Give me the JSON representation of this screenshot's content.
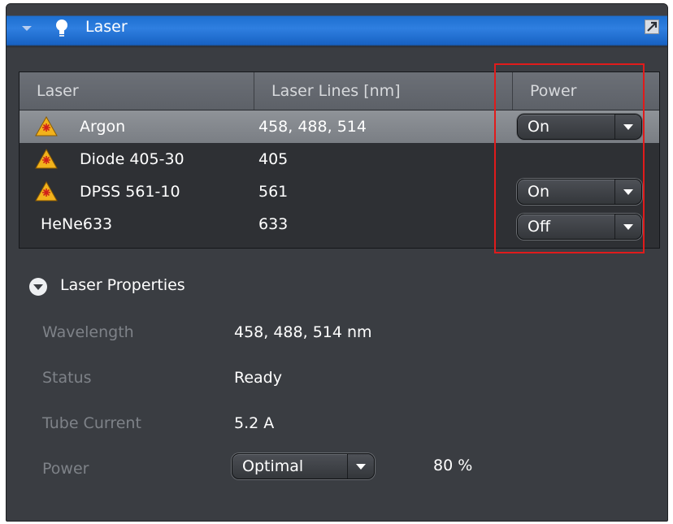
{
  "panel": {
    "title": "Laser"
  },
  "table": {
    "headers": [
      "Laser",
      "Laser Lines [nm]",
      "Power"
    ],
    "rows": [
      {
        "name": "Argon",
        "lines": "458, 488, 514",
        "power": "On",
        "selected": true,
        "warning_icon": true
      },
      {
        "name": "Diode 405-30",
        "lines": "405",
        "power": "",
        "selected": false,
        "warning_icon": true
      },
      {
        "name": "DPSS 561-10",
        "lines": "561",
        "power": "On",
        "selected": false,
        "warning_icon": true
      },
      {
        "name": "HeNe633",
        "lines": "633",
        "power": "Off",
        "selected": false,
        "warning_icon": false
      }
    ]
  },
  "properties": {
    "title": "Laser Properties",
    "wavelength_label": "Wavelength",
    "wavelength_value": "458, 488, 514 nm",
    "status_label": "Status",
    "status_value": "Ready",
    "tube_current_label": "Tube Current",
    "tube_current_value": "5.2 A",
    "power_label": "Power",
    "power_mode": "Optimal",
    "power_percent": "80 %"
  },
  "colors": {
    "titlebar_blue": "#1d6fd0",
    "panel_bg": "#3a3d42",
    "highlight_red": "#e01b1b",
    "warning_yellow": "#f2b21c"
  },
  "icons": {
    "collapse": "chevron-down-icon",
    "bulb": "lightbulb-icon",
    "popout": "popout-icon",
    "warning": "laser-warning-icon"
  }
}
